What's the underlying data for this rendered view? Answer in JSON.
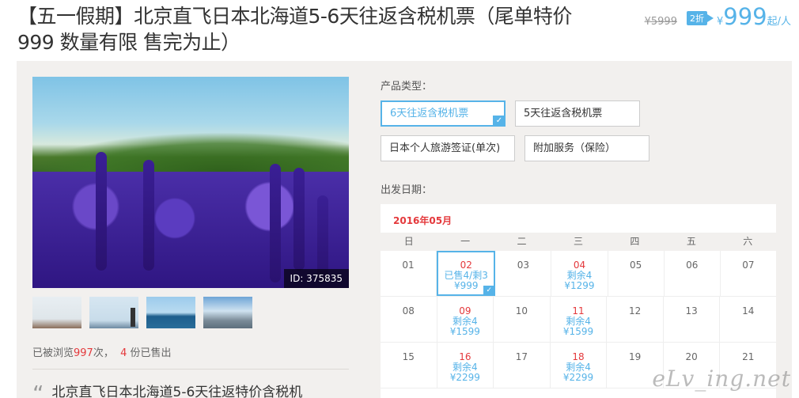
{
  "header": {
    "title": "【五一假期】北京直飞日本北海道5-6天往返含税机票（尾单特价999 数量有限 售完为止）",
    "old_price": "¥5999",
    "discount": "2折",
    "currency": "¥",
    "price": "999",
    "unit": "起/人"
  },
  "gallery": {
    "image_id": "ID: 375835",
    "thumbnails": [
      "thumb-1",
      "thumb-2",
      "thumb-3",
      "thumb-4"
    ]
  },
  "stats": {
    "prefix": "已被浏览",
    "views": "997",
    "mid": "次，",
    "sold": "4",
    "suffix": "份已售出"
  },
  "description": {
    "quote_mark": "“",
    "text": "北京直飞日本北海道5-6天往返特价含税机"
  },
  "product_type": {
    "label": "产品类型：",
    "options": [
      {
        "label": "6天往返含税机票",
        "selected": true
      },
      {
        "label": "5天往返含税机票",
        "selected": false
      },
      {
        "label": "日本个人旅游签证(单次)",
        "selected": false
      },
      {
        "label": "附加服务（保险）",
        "selected": false
      }
    ]
  },
  "departure": {
    "label": "出发日期：",
    "month": "2016年05月",
    "weekdays": [
      "日",
      "一",
      "二",
      "三",
      "四",
      "五",
      "六"
    ],
    "rows": [
      [
        {
          "d": "01"
        },
        {
          "d": "02",
          "s": "已售4/剩3",
          "p": "¥999",
          "avail": true,
          "sel": true
        },
        {
          "d": "03"
        },
        {
          "d": "04",
          "s": "剩余4",
          "p": "¥1299",
          "avail": true
        },
        {
          "d": "05"
        },
        {
          "d": "06"
        },
        {
          "d": "07"
        }
      ],
      [
        {
          "d": "08"
        },
        {
          "d": "09",
          "s": "剩余4",
          "p": "¥1599",
          "avail": true
        },
        {
          "d": "10"
        },
        {
          "d": "11",
          "s": "剩余4",
          "p": "¥1599",
          "avail": true
        },
        {
          "d": "12"
        },
        {
          "d": "13"
        },
        {
          "d": "14"
        }
      ],
      [
        {
          "d": "15"
        },
        {
          "d": "16",
          "s": "剩余4",
          "p": "¥2299",
          "avail": true
        },
        {
          "d": "17"
        },
        {
          "d": "18",
          "s": "剩余4",
          "p": "¥2299",
          "avail": true
        },
        {
          "d": "19"
        },
        {
          "d": "20"
        },
        {
          "d": "21"
        }
      ]
    ]
  },
  "watermark": "eLv_ing.net",
  "colors": {
    "accent": "#56b3e8",
    "highlight": "#e4393c",
    "panel": "#f2f0ee"
  }
}
